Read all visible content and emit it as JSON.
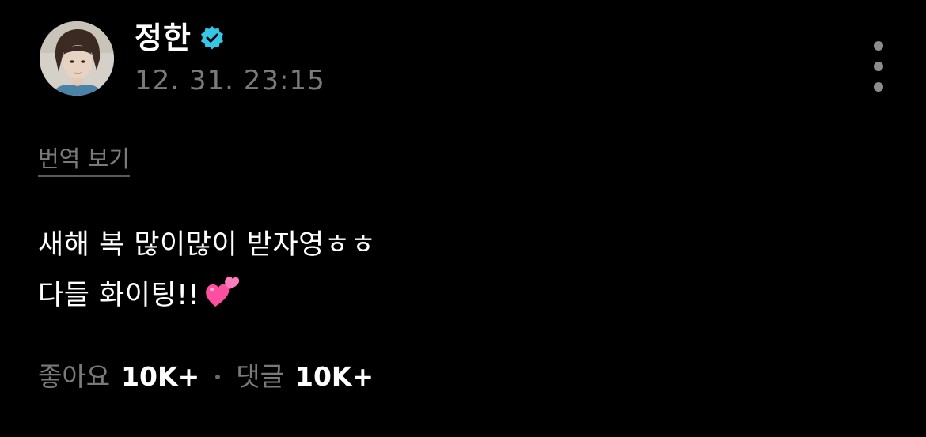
{
  "author": {
    "name": "정한",
    "verified_icon": "verified-badge-icon",
    "timestamp": "12. 31. 23:15"
  },
  "menu": {
    "icon": "more-vertical-icon"
  },
  "translate_link": "번역 보기",
  "post": {
    "line1": "새해 복 많이많이 받자영ㅎㅎ",
    "line2": "다들 화이팅!!",
    "emoji": "two-hearts-icon"
  },
  "footer": {
    "likes_label": "좋아요",
    "likes_count": "10K+",
    "comments_label": "댓글",
    "comments_count": "10K+"
  },
  "colors": {
    "background": "#000000",
    "verified": "#35c7e6",
    "muted_text": "#7a7a7a",
    "heart": "#ff5fa8"
  }
}
